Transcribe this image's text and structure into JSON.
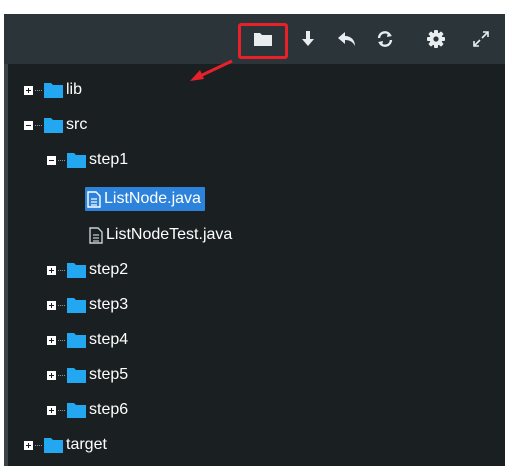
{
  "toolbar": {
    "buttons": [
      {
        "icon": "folder-icon",
        "highlighted": true
      },
      {
        "icon": "download-arrow-icon"
      },
      {
        "icon": "undo-icon"
      },
      {
        "icon": "refresh-icon"
      },
      {
        "icon": "gear-icon"
      },
      {
        "icon": "expand-icon"
      }
    ],
    "highlight_color": "#e8202a"
  },
  "tree": {
    "root_lib": "lib",
    "root_src": "src",
    "step1": "step1",
    "file_listnode": "ListNode.java",
    "file_listnodetest": "ListNodeTest.java",
    "step2": "step2",
    "step3": "step3",
    "step4": "step4",
    "step5": "step5",
    "step6": "step6",
    "root_target": "target"
  },
  "colors": {
    "panel_bg": "#1a1f21",
    "toolbar_bg": "#2b3539",
    "folder": "#22a7f0",
    "selection": "#2d83db",
    "text": "#ffffff"
  }
}
